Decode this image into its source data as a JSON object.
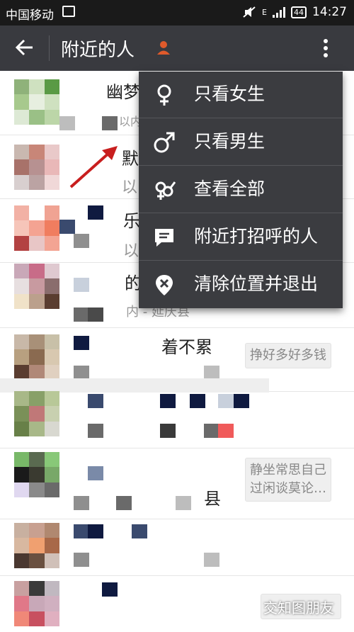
{
  "status_bar": {
    "carrier": "中国移动",
    "signal_type": "E",
    "battery": "44",
    "time": "14:27"
  },
  "app_bar": {
    "title": "附近的人",
    "accent_color": "#e05a2b"
  },
  "menu": {
    "items": [
      {
        "label": "只看女生",
        "icon": "female-icon"
      },
      {
        "label": "只看男生",
        "icon": "male-icon"
      },
      {
        "label": "查看全部",
        "icon": "gender-all-icon"
      },
      {
        "label": "附近打招呼的人",
        "icon": "message-icon"
      },
      {
        "label": "清除位置并退出",
        "icon": "location-clear-icon"
      }
    ]
  },
  "list": {
    "fragments": [
      {
        "text": "幽梦",
        "sub": "以内"
      },
      {
        "text": "默",
        "sub": "以"
      },
      {
        "text": "乐",
        "sub": "以"
      },
      {
        "text": "的",
        "sub": "内 - 延庆县"
      },
      {
        "text": "着不累",
        "sub": ""
      }
    ],
    "bubbles": [
      "挣好多好多钱",
      "静坐常思自己\n过闲谈莫论…"
    ],
    "extra_fragment": "县"
  },
  "watermark": "交知图朋友"
}
